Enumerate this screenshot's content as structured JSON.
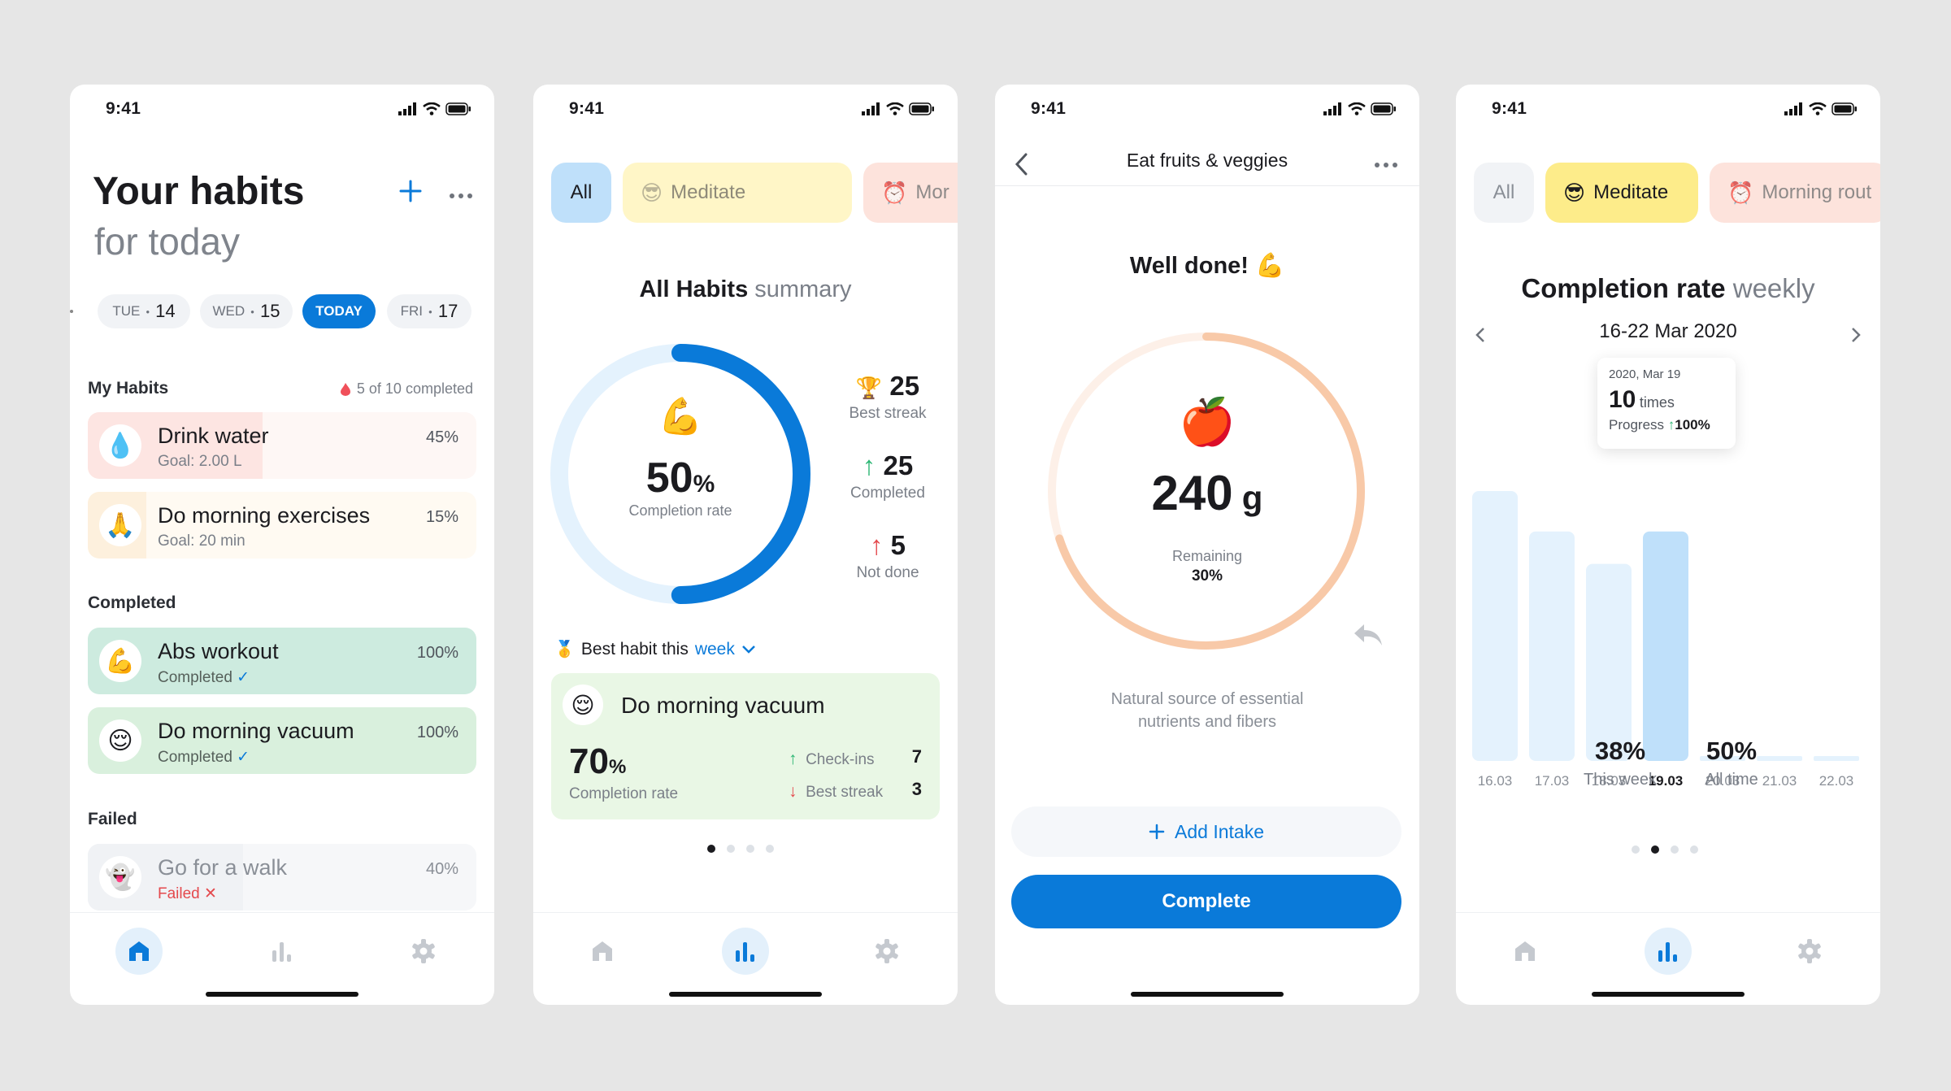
{
  "status": {
    "time": "9:41"
  },
  "colors": {
    "primary": "#0a7ad9",
    "water": "#fde5e2",
    "green": "#d7f0e4",
    "failed": "#e4494d",
    "orange": "#f8c9a8"
  },
  "screen1": {
    "title": "Your habits",
    "subtitle": "for today",
    "days": [
      {
        "dow": "TUE",
        "num": "14"
      },
      {
        "dow": "WED",
        "num": "15"
      },
      {
        "dow": "TODAY",
        "num": ""
      },
      {
        "dow": "FRI",
        "num": "17"
      }
    ],
    "my_habits_label": "My Habits",
    "completed_count": "5 of 10 completed",
    "habits": [
      {
        "name": "Drink water",
        "sub": "Goal: 2.00 L",
        "pct": "45%",
        "progress": 0.45,
        "icon": "water-drop-icon"
      },
      {
        "name": "Do morning exercises",
        "sub": "Goal: 20 min",
        "pct": "15%",
        "progress": 0.15,
        "icon": "praying-hands-icon"
      }
    ],
    "completed_label": "Completed",
    "completed": [
      {
        "name": "Abs workout",
        "sub": "Completed",
        "pct": "100%",
        "icon": "flexed-biceps-icon"
      },
      {
        "name": "Do morning vacuum",
        "sub": "Completed",
        "pct": "100%",
        "icon": "relieved-face-icon"
      }
    ],
    "failed_label": "Failed",
    "failed": [
      {
        "name": "Go for a walk",
        "sub": "Failed",
        "pct": "40%",
        "progress": 0.4,
        "icon": "ghost-icon"
      }
    ]
  },
  "screen2": {
    "tabs": [
      "All",
      "Meditate",
      "Mor"
    ],
    "summary_title": "All Habits",
    "summary_suffix": "summary",
    "completion_pct": "50",
    "completion_value": 0.5,
    "completion_label": "Completion rate",
    "stats": [
      {
        "value": "25",
        "label": "Best streak",
        "icon": "trophy-icon"
      },
      {
        "value": "25",
        "label": "Completed",
        "icon": "arrow-up-icon"
      },
      {
        "value": "5",
        "label": "Not done",
        "icon": "arrow-up-red-icon"
      }
    ],
    "best_habit_prefix": "Best habit this",
    "best_habit_period": "week",
    "best": {
      "name": "Do morning vacuum",
      "pct": "70",
      "rate_label": "Completion rate",
      "checkins_label": "Check-ins",
      "checkins": "7",
      "streak_label": "Best streak",
      "streak": "3"
    }
  },
  "screen3": {
    "title": "Eat fruits & veggies",
    "well_done": "Well done!",
    "amount": "240",
    "unit": "g",
    "remaining_label": "Remaining",
    "remaining_pct": "30%",
    "remaining_value": 0.3,
    "description": "Natural source of essential nutrients and fibers",
    "add_intake": "Add Intake",
    "complete": "Complete"
  },
  "screen4": {
    "tabs": [
      "All",
      "Meditate",
      "Morning rout"
    ],
    "title": "Completion rate",
    "title_suffix": "weekly",
    "range": "16-22 Mar 2020",
    "tooltip": {
      "date": "2020, Mar 19",
      "value": "10",
      "unit": "times",
      "progress_label": "Progress",
      "progress": "100%"
    },
    "this_week_value": "38%",
    "this_week_label": "This week",
    "all_time_value": "50%",
    "all_time_label": "All time"
  },
  "chart_data": {
    "type": "bar",
    "categories": [
      "16.03",
      "17.03",
      "18.03",
      "19.03",
      "20.03",
      "21.03",
      "22.03"
    ],
    "values": [
      10,
      8.5,
      7.3,
      8.5,
      0,
      0,
      0
    ],
    "highlight": "19.03",
    "ylim": [
      0,
      10
    ]
  }
}
